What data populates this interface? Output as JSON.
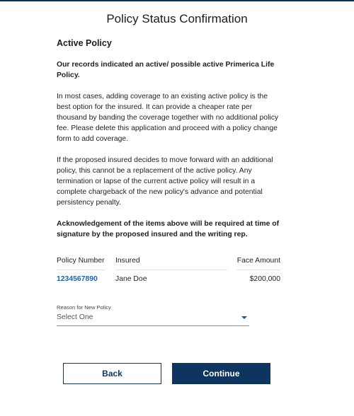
{
  "page": {
    "title": "Policy Status Confirmation"
  },
  "section": {
    "heading": "Active Policy",
    "intro_bold": "Our records indicated an active/ possible active Primerica Life Policy.",
    "paragraph_1": "In most cases, adding coverage to an existing active policy is the best option for the insured. It can provide a cheaper rate per thousand by banding the coverage together with no additional policy fee. Please delete this application and proceed with a policy change form to add coverage.",
    "paragraph_2": "If the proposed insured decides to move forward with an additional policy, this cannot be a replacement of the active policy. Any termination or lapse of the current active policy will result in a complete chargeback of the new policy's advance and potential persistency penalty.",
    "acknowledgement_bold": "Acknowledgement of the items above will be required at time of signature by the proposed insured and the writing rep."
  },
  "table": {
    "headers": {
      "policy_number": "Policy Number",
      "insured": "Insured",
      "face_amount": "Face Amount"
    },
    "rows": [
      {
        "policy_number": "1234567890",
        "insured": "Jane Doe",
        "face_amount": "$200,000"
      }
    ]
  },
  "reason_select": {
    "label": "Reason for New Policy",
    "value": "Select One",
    "icon": "chevron-down-icon"
  },
  "buttons": {
    "back_label": "Back",
    "continue_label": "Continue"
  },
  "colors": {
    "primary": "#0e355f",
    "link": "#1a64b0",
    "caret": "#1a5a9c"
  }
}
